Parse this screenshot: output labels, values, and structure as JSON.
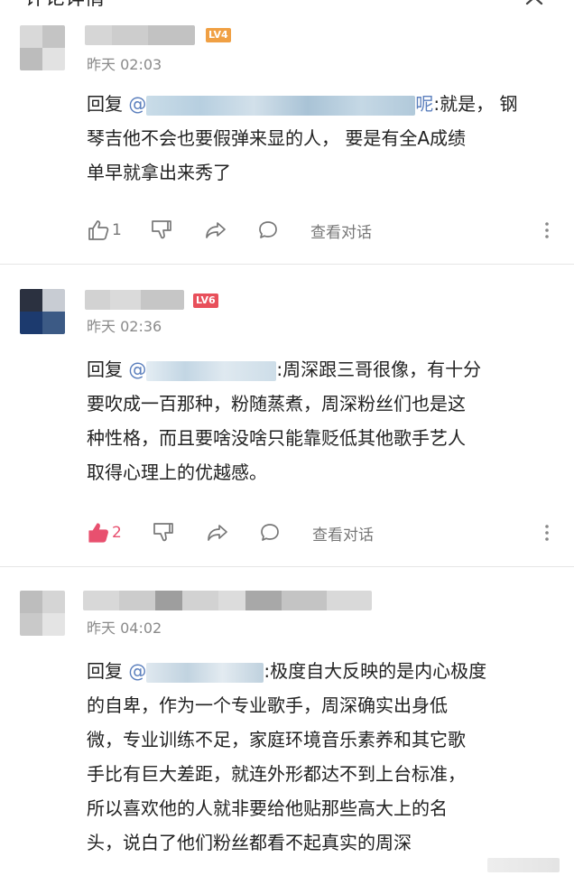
{
  "header": {
    "title": "评论详情"
  },
  "comments": [
    {
      "level": "LV4",
      "time": "昨天 02:03",
      "reply_prefix": "回复",
      "mention_start": "@",
      "mention_end": "呢",
      "text_line1": ":就是， 钢",
      "text_rest": [
        "琴吉他不会也要假弹来显的人， 要是有全A成绩",
        "单早就拿出来秀了"
      ],
      "likes": "1",
      "view_conversation": "查看对话"
    },
    {
      "level": "LV6",
      "time": "昨天 02:36",
      "reply_prefix": "回复",
      "mention_start": "@",
      "text_line1": ":周深跟三哥很像，有十分",
      "text_rest": [
        "要吹成一百那种，粉随蒸煮，周深粉丝们也是这",
        "种性格，而且要啥没啥只能靠贬低其他歌手艺人",
        "取得心理上的优越感。"
      ],
      "likes": "2",
      "view_conversation": "查看对话"
    },
    {
      "time": "昨天 04:02",
      "reply_prefix": "回复",
      "mention_start": "@",
      "text_line1": ":极度自大反映的是内心极度",
      "text_rest": [
        "的自卑，作为一个专业歌手，周深确实出身低",
        "微，专业训练不足，家庭环境音乐素养和其它歌",
        "手比有巨大差距，就连外形都达不到上台标准，",
        "所以喜欢他的人就非要给他贴那些高大上的名",
        "头，说白了他们粉丝都看不起真实的周深"
      ]
    }
  ],
  "colors": {
    "mention": "#5b7fbd",
    "like_active": "#e8506f",
    "lv4": "#f0a044",
    "lv6": "#e8505b"
  },
  "icons": [
    "close-icon",
    "thumbs-up-icon",
    "thumbs-down-icon",
    "share-icon",
    "comment-icon",
    "more-vertical-icon"
  ]
}
